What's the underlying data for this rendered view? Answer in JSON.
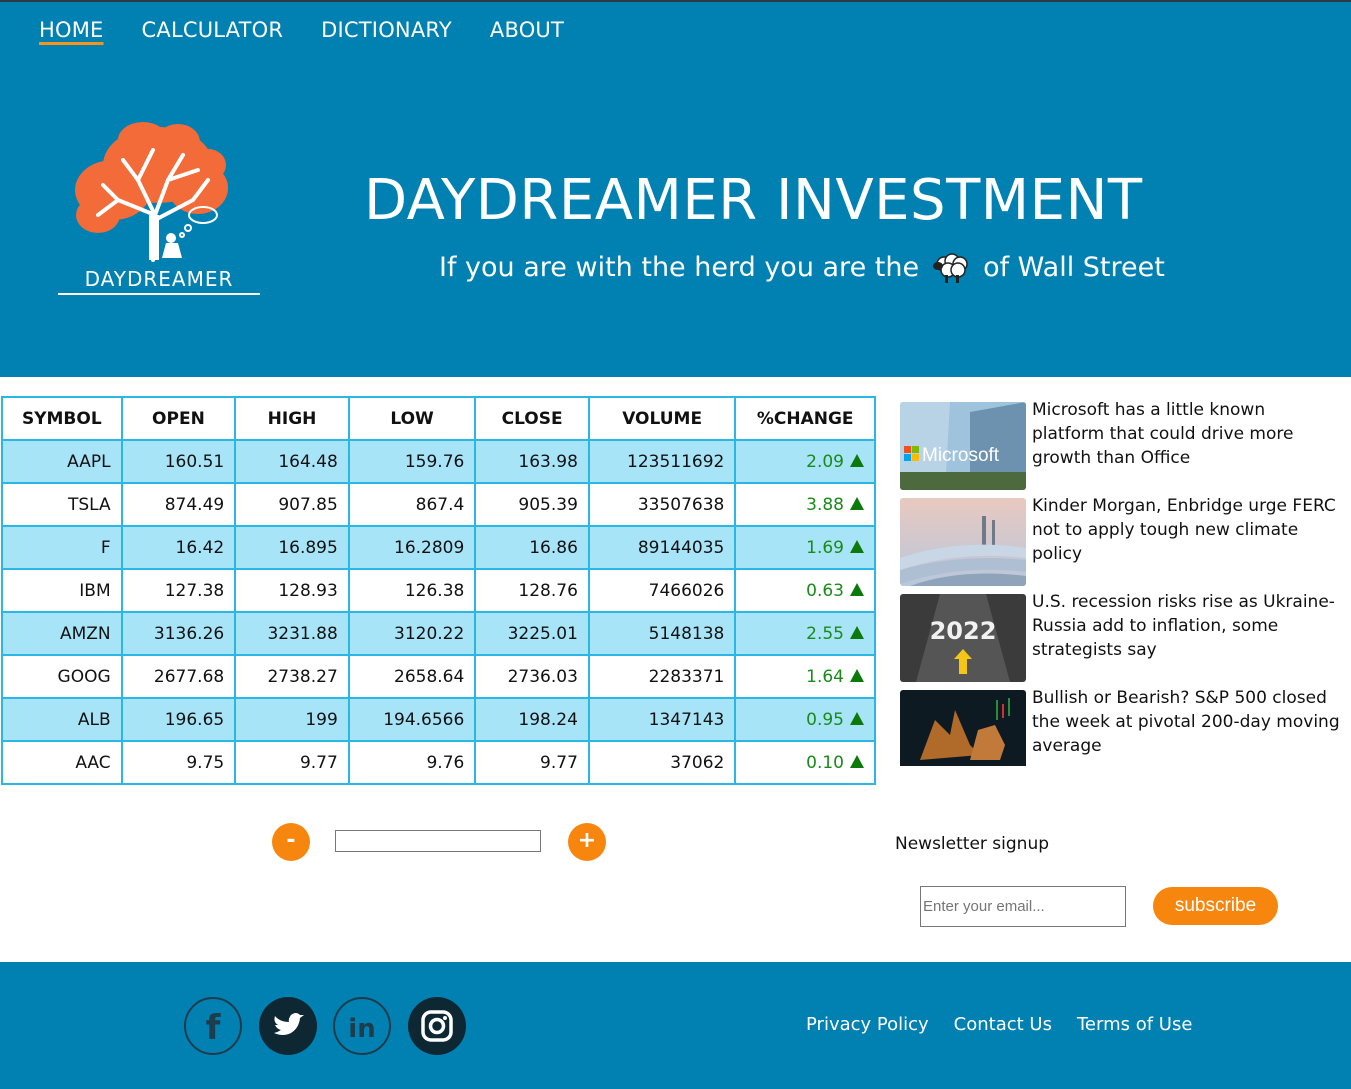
{
  "nav": {
    "items": [
      {
        "label": "HOME",
        "active": true
      },
      {
        "label": "CALCULATOR"
      },
      {
        "label": "DICTIONARY"
      },
      {
        "label": "ABOUT"
      }
    ]
  },
  "brand": {
    "logo_text": "DAYDREAMER",
    "title": "DAYDREAMER INVESTMENT",
    "tagline_before": "If you are with the herd you are the",
    "tagline_icon": "sheep-icon",
    "tagline_after": "of Wall Street"
  },
  "colors": {
    "header_bg": "#0180b2",
    "accent": "#f7860f",
    "row_alt": "#a8e4f8",
    "table_border": "#2ab7e6",
    "positive": "#1a8a1a"
  },
  "table": {
    "headers": [
      "SYMBOL",
      "OPEN",
      "HIGH",
      "LOW",
      "CLOSE",
      "VOLUME",
      "%CHANGE"
    ],
    "rows": [
      [
        "AAPL",
        "160.51",
        "164.48",
        "159.76",
        "163.98",
        "123511692",
        "2.09"
      ],
      [
        "TSLA",
        "874.49",
        "907.85",
        "867.4",
        "905.39",
        "33507638",
        "3.88"
      ],
      [
        "F",
        "16.42",
        "16.895",
        "16.2809",
        "16.86",
        "89144035",
        "1.69"
      ],
      [
        "IBM",
        "127.38",
        "128.93",
        "126.38",
        "128.76",
        "7466026",
        "0.63"
      ],
      [
        "AMZN",
        "3136.26",
        "3231.88",
        "3120.22",
        "3225.01",
        "5148138",
        "2.55"
      ],
      [
        "GOOG",
        "2677.68",
        "2738.27",
        "2658.64",
        "2736.03",
        "2283371",
        "1.64"
      ],
      [
        "ALB",
        "196.65",
        "199",
        "194.6566",
        "198.24",
        "1347143",
        "0.95"
      ],
      [
        "AAC",
        "9.75",
        "9.77",
        "9.76",
        "9.77",
        "37062",
        "0.10"
      ]
    ]
  },
  "pager": {
    "minus": "-",
    "plus": "+",
    "value": ""
  },
  "news": [
    {
      "headline": "Microsoft has a little known platform that could drive more growth than Office",
      "thumb_label": "Microsoft"
    },
    {
      "headline": "Kinder Morgan, Enbridge urge FERC not to apply tough new climate policy",
      "thumb_label": ""
    },
    {
      "headline": "U.S. recession risks rise as Ukraine-Russia add to inflation, some strategists say",
      "thumb_label": "2022"
    },
    {
      "headline": "Bullish or Bearish? S&P 500 closed the week at pivotal 200-day moving average",
      "thumb_label": ""
    }
  ],
  "newsletter": {
    "label": "Newsletter signup",
    "placeholder": "Enter your email...",
    "button": "subscribe"
  },
  "footer": {
    "social": [
      "facebook-icon",
      "twitter-icon",
      "linkedin-icon",
      "instagram-icon"
    ],
    "links": [
      "Privacy Policy",
      "Contact Us",
      "Terms of Use"
    ]
  }
}
